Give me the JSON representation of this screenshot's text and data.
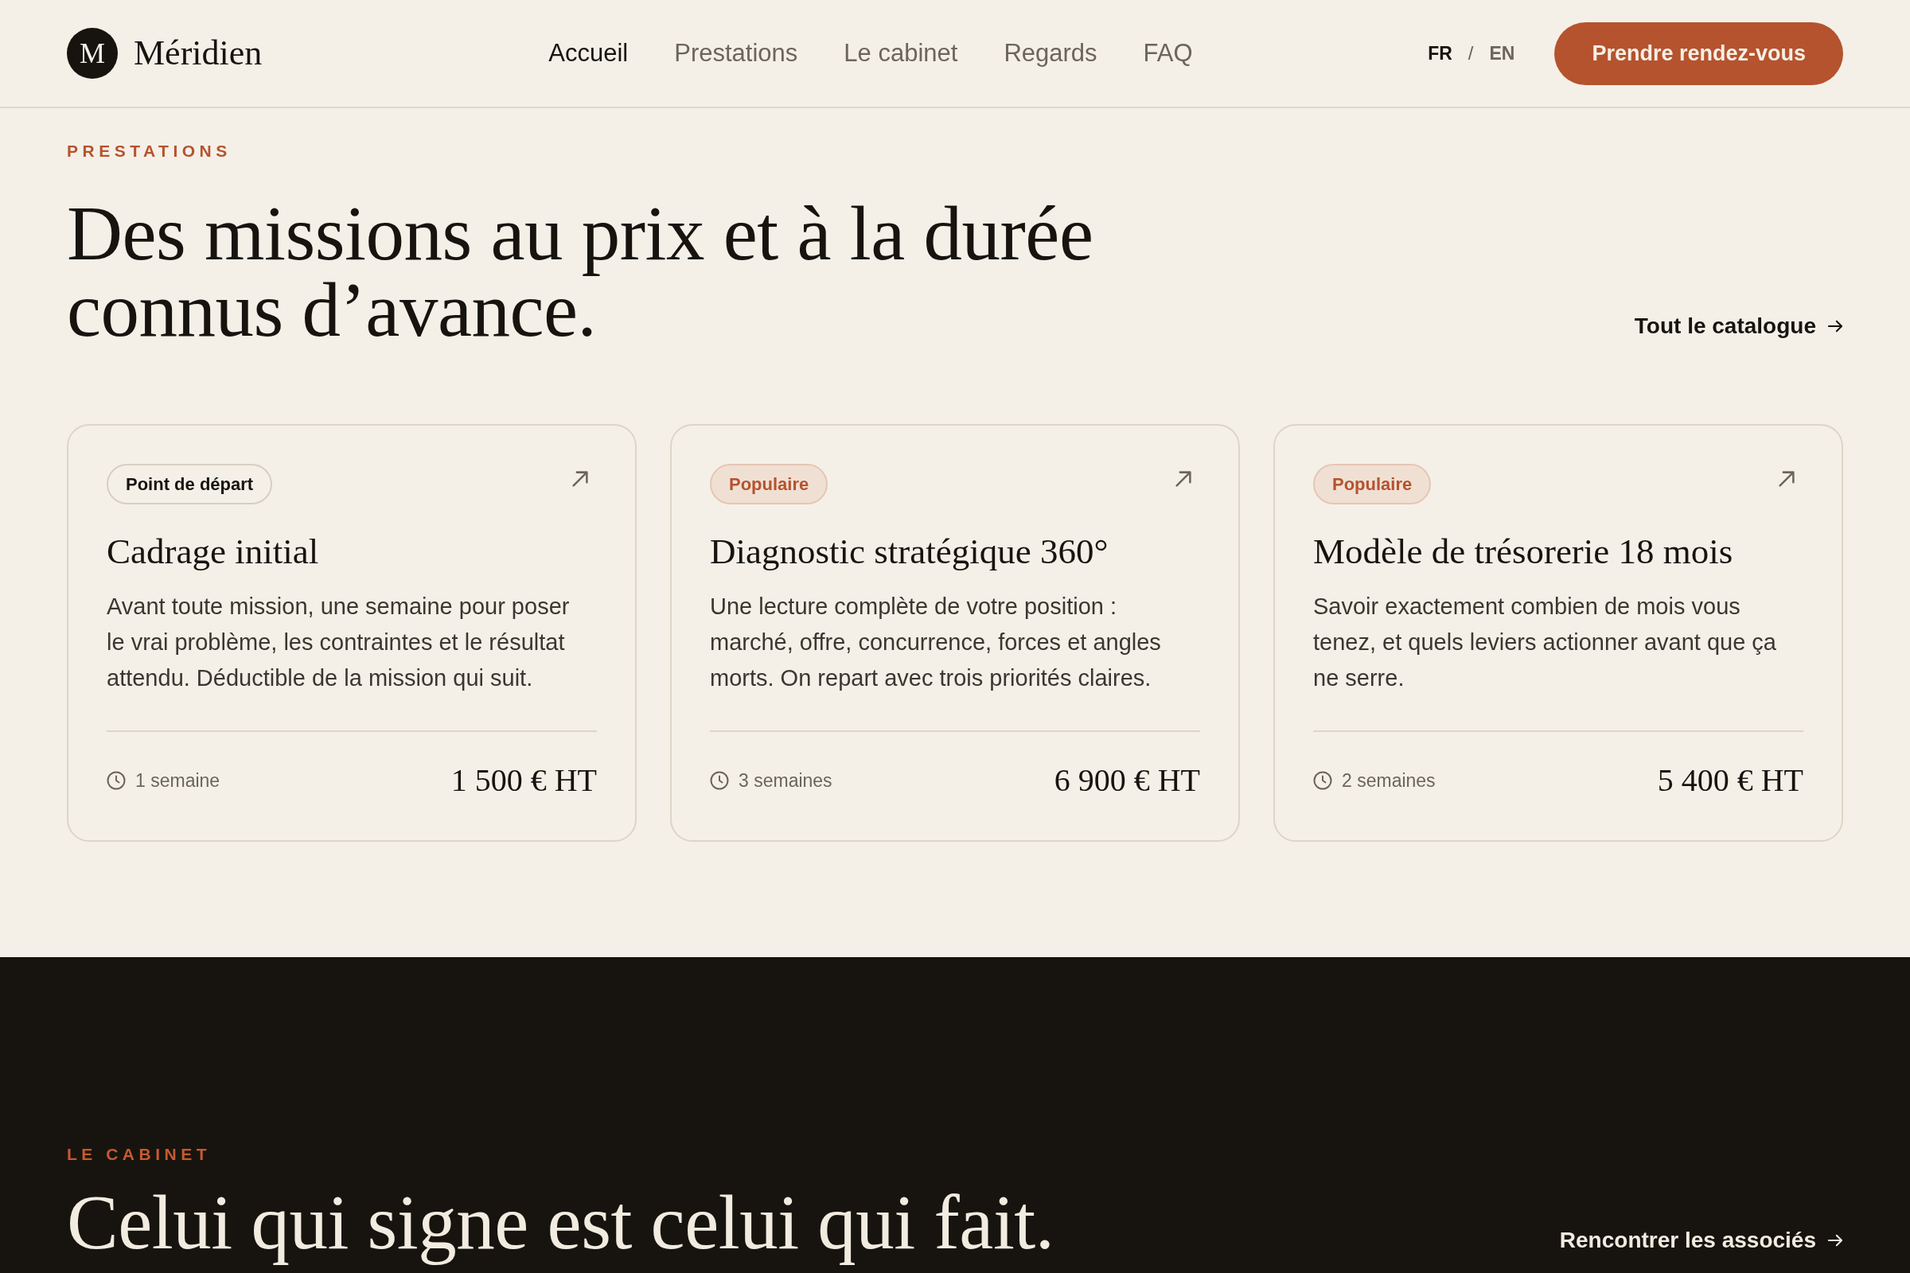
{
  "header": {
    "logo": {
      "mark": "M",
      "name": "Méridien"
    },
    "nav": [
      {
        "label": "Accueil",
        "selected": true
      },
      {
        "label": "Prestations",
        "selected": false
      },
      {
        "label": "Le cabinet",
        "selected": false
      },
      {
        "label": "Regards",
        "selected": false
      },
      {
        "label": "FAQ",
        "selected": false
      }
    ],
    "languages": [
      {
        "label": "FR",
        "selected": true
      },
      {
        "label": "EN",
        "selected": false
      }
    ],
    "language_separator": "/",
    "cta": "Prendre rendez-vous"
  },
  "services": {
    "eyebrow": "PRESTATIONS",
    "heading": "Des missions au prix et à la durée connus d’avance.",
    "link": "Tout le catalogue",
    "cards": [
      {
        "badge": {
          "label": "Point de départ",
          "kind": "outline"
        },
        "title": "Cadrage initial",
        "description": "Avant toute mission, une semaine pour poser le vrai problème, les contraintes et le résultat attendu. Déductible de la mission qui suit.",
        "duration": "1 semaine",
        "price": "1 500 € HT"
      },
      {
        "badge": {
          "label": "Populaire",
          "kind": "highlight"
        },
        "title": "Diagnostic stratégique 360°",
        "description": "Une lecture complète de votre position : marché, offre, concurrence, forces et angles morts. On repart avec trois priorités claires.",
        "duration": "3 semaines",
        "price": "6 900 € HT"
      },
      {
        "badge": {
          "label": "Populaire",
          "kind": "highlight"
        },
        "title": "Modèle de trésorerie 18 mois",
        "description": "Savoir exactement combien de mois vous tenez, et quels leviers actionner avant que ça ne serre.",
        "duration": "2 semaines",
        "price": "5 400 € HT"
      }
    ]
  },
  "cabinet": {
    "eyebrow": "LE CABINET",
    "heading": "Celui qui signe est celui qui fait.",
    "link": "Rencontrer les associés"
  }
}
